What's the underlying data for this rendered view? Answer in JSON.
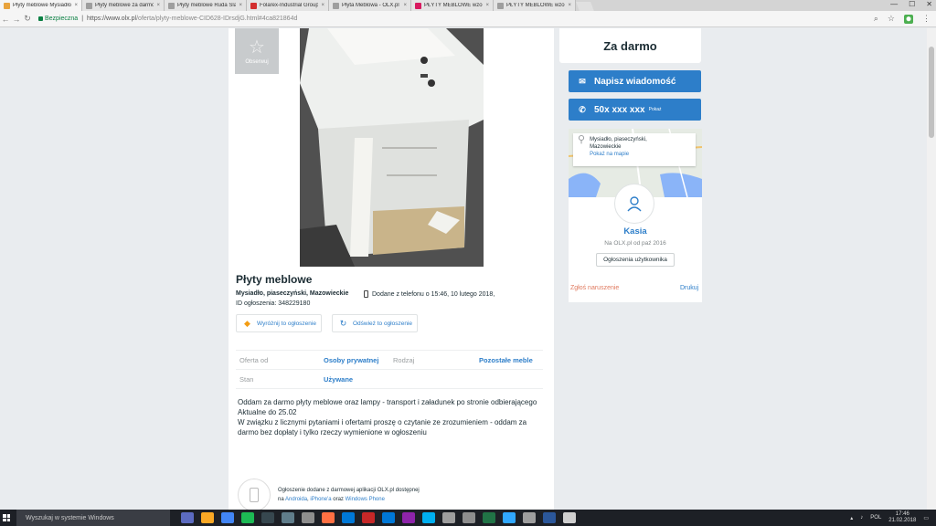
{
  "browser": {
    "tabs": [
      {
        "label": "Płyty meblowe Mysiadło",
        "active": true,
        "color": "#e8a33d"
      },
      {
        "label": "Płyty meblowe za darmo",
        "active": false,
        "color": "#9e9e9e"
      },
      {
        "label": "Płyty meblowe Ruda Śląsk",
        "active": false,
        "color": "#9e9e9e"
      },
      {
        "label": "Folarex-Industrial Group",
        "active": false,
        "color": "#d32f2f"
      },
      {
        "label": "Płyta Meblowa - OLX.pl",
        "active": false,
        "color": "#9e9e9e"
      },
      {
        "label": "PŁYTY MEBLOWE wzornik",
        "active": false,
        "color": "#d81b60"
      },
      {
        "label": "PŁYTY MEBLOWE wzornik",
        "active": false,
        "color": "#9e9e9e"
      }
    ],
    "secure_label": "Bezpieczna",
    "url_host": "https://www.olx.pl",
    "url_path": "/oferta/plyty-meblowe-CID628-IDrsdjG.html#4ca821864d",
    "window_controls": [
      "—",
      "☐",
      "✕"
    ]
  },
  "listing": {
    "observe_label": "Obserwuj",
    "title": "Płyty meblowe",
    "location": "Mysiadło, piaseczyński, Mazowieckie",
    "added": "Dodane z telefonu   o 15:46, 10 lutego 2018,",
    "ad_id": "ID ogłoszenia: 348229180",
    "promote_label": "Wyróżnij to ogłoszenie",
    "refresh_label": "Odśwież to ogłoszenie",
    "params": [
      {
        "key": "Oferta od",
        "value": "Osoby prywatnej",
        "key2": "Rodzaj",
        "value2": "Pozostałe meble"
      },
      {
        "key": "Stan",
        "value": "Używane",
        "key2": "",
        "value2": ""
      }
    ],
    "description": [
      "Oddam za darmo płyty meblowe oraz lampy - transport i załadunek po stronie odbierającego",
      "Aktualne do 25.02",
      "W związku z licznymi pytaniami i ofertami proszę o czytanie ze zrozumieniem - oddam za",
      "darmo bez dopłaty i tylko rzeczy wymienione w ogłoszeniu"
    ],
    "app_note_line1": "Ogłoszenie dodane z darmowej aplikacji OLX.pl dostępnej",
    "app_note_prefix": "na ",
    "app_note_android": "Androida",
    "app_note_sep1": ", ",
    "app_note_iphone": "iPhone'a",
    "app_note_sep2": " oraz ",
    "app_note_winphone": "Windows Phone"
  },
  "sidebar": {
    "price": "Za darmo",
    "message_button": "Napisz wiadomość",
    "phone_number": "50x xxx xxx",
    "phone_show": "Pokaż",
    "map_address_line1": "Mysiadło, piaseczyński,",
    "map_address_line2": "Mazowieckie",
    "map_link": "Pokaż na mapie",
    "user_name": "Kasia",
    "user_since": "Na OLX.pl od paź 2016",
    "user_ads": "Ogłoszenia użytkownika",
    "report": "Zgłoś naruszenie",
    "print": "Drukuj",
    "accent": "#2d7ec9"
  },
  "taskbar": {
    "search_placeholder": "Wyszukaj w systemie Windows",
    "lang": "POL",
    "time": "17:46",
    "date": "21.02.2018",
    "apps": [
      "#5c6bc0",
      "#f9a825",
      "#4285f4",
      "#1db954",
      "#37474f",
      "#607d8b",
      "#8e8e8e",
      "#ff7043",
      "#0078d7",
      "#c62828",
      "#0078d7",
      "#8e24aa",
      "#00aff0",
      "#9e9e9e",
      "#8e8e8e",
      "#217346",
      "#31a8ff",
      "#9e9e9e",
      "#2b579a",
      "#cfcfcf"
    ]
  }
}
